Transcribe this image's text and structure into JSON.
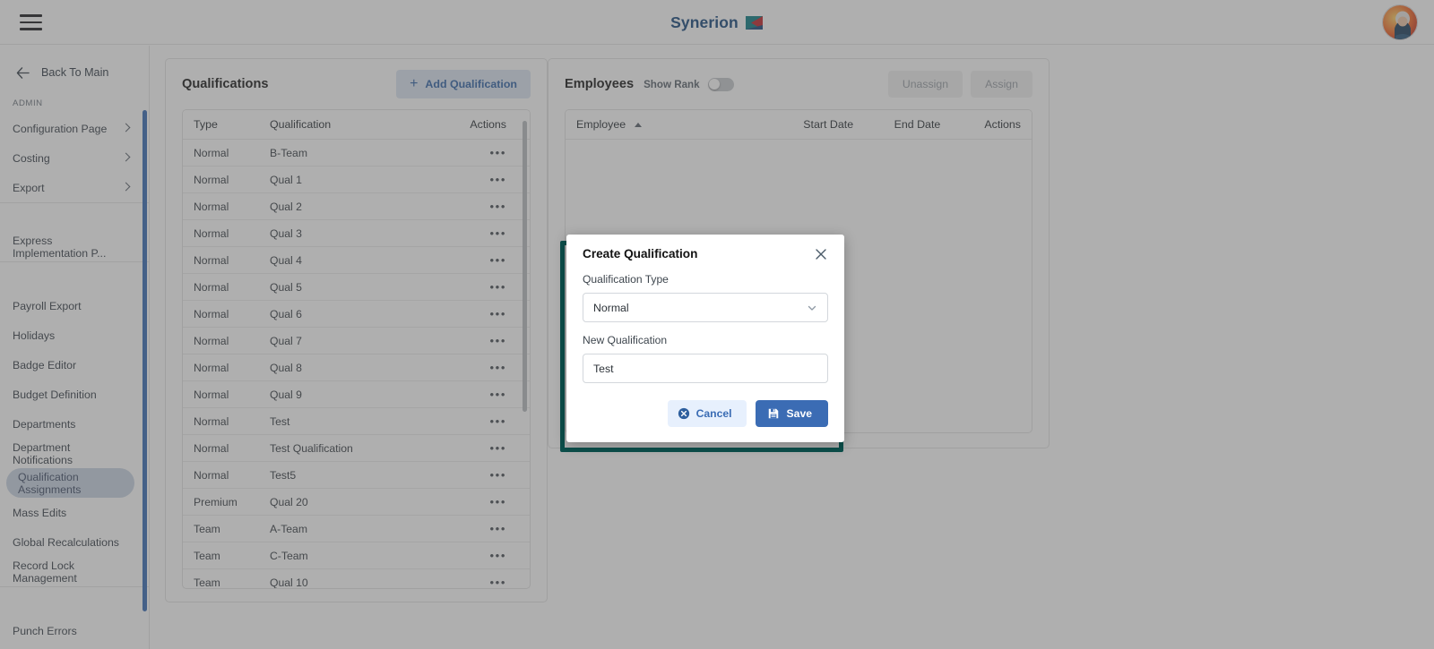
{
  "topbar": {
    "menu_icon": "hamburger-menu-icon",
    "brand_text": "Synerion",
    "brand_mark_icon": "synerion-logo-mark",
    "avatar_icon": "user-avatar"
  },
  "sidebar": {
    "back_label": "Back To Main",
    "back_icon": "arrow-left-icon",
    "section_label": "ADMIN",
    "groups": [
      {
        "items": [
          {
            "label": "Configuration Page",
            "expandable": true,
            "selected": false
          },
          {
            "label": "Costing",
            "expandable": true,
            "selected": false
          },
          {
            "label": "Export",
            "expandable": true,
            "selected": false
          }
        ]
      },
      {
        "items": [
          {
            "label": "Express Implementation P...",
            "expandable": false,
            "selected": false
          }
        ]
      },
      {
        "items": [
          {
            "label": "Payroll Export",
            "expandable": false,
            "selected": false
          },
          {
            "label": "Holidays",
            "expandable": false,
            "selected": false
          },
          {
            "label": "Badge Editor",
            "expandable": false,
            "selected": false
          },
          {
            "label": "Budget Definition",
            "expandable": false,
            "selected": false
          },
          {
            "label": "Departments",
            "expandable": false,
            "selected": false
          },
          {
            "label": "Department Notifications",
            "expandable": false,
            "selected": false
          },
          {
            "label": "Qualification Assignments",
            "expandable": false,
            "selected": true
          },
          {
            "label": "Mass Edits",
            "expandable": false,
            "selected": false
          },
          {
            "label": "Global Recalculations",
            "expandable": false,
            "selected": false
          },
          {
            "label": "Record Lock Management",
            "expandable": false,
            "selected": false
          }
        ]
      },
      {
        "items": [
          {
            "label": "Punch Errors",
            "expandable": false,
            "selected": false
          }
        ]
      }
    ],
    "scrollbar_color": "#3a6eb5"
  },
  "qualifications_panel": {
    "title": "Qualifications",
    "add_button_label": "Add Qualification",
    "add_button_icon": "plus-icon",
    "columns": [
      "Type",
      "Qualification",
      "Actions"
    ],
    "rows": [
      {
        "type": "Normal",
        "qualification": "B-Team"
      },
      {
        "type": "Normal",
        "qualification": "Qual 1"
      },
      {
        "type": "Normal",
        "qualification": "Qual 2"
      },
      {
        "type": "Normal",
        "qualification": "Qual 3"
      },
      {
        "type": "Normal",
        "qualification": "Qual 4"
      },
      {
        "type": "Normal",
        "qualification": "Qual 5"
      },
      {
        "type": "Normal",
        "qualification": "Qual 6"
      },
      {
        "type": "Normal",
        "qualification": "Qual 7"
      },
      {
        "type": "Normal",
        "qualification": "Qual 8"
      },
      {
        "type": "Normal",
        "qualification": "Qual 9"
      },
      {
        "type": "Normal",
        "qualification": "Test"
      },
      {
        "type": "Normal",
        "qualification": "Test Qualification"
      },
      {
        "type": "Normal",
        "qualification": "Test5"
      },
      {
        "type": "Premium",
        "qualification": "Qual 20"
      },
      {
        "type": "Team",
        "qualification": "A-Team"
      },
      {
        "type": "Team",
        "qualification": "C-Team"
      },
      {
        "type": "Team",
        "qualification": "Qual 10"
      }
    ],
    "row_action_icon": "ellipsis-menu-icon"
  },
  "employees_panel": {
    "title": "Employees",
    "show_rank_label": "Show Rank",
    "show_rank_on": false,
    "unassign_label": "Unassign",
    "assign_label": "Assign",
    "columns": [
      "Employee",
      "Start Date",
      "End Date",
      "Actions"
    ],
    "sort_column": "Employee",
    "sort_direction": "ascending",
    "sort_icon": "caret-up-icon",
    "rows": []
  },
  "modal": {
    "title": "Create Qualification",
    "close_icon": "close-icon",
    "type_label": "Qualification Type",
    "type_value": "Normal",
    "type_chevron_icon": "chevron-down-icon",
    "name_label": "New Qualification",
    "name_value": "Test",
    "name_placeholder": "",
    "cancel_label": "Cancel",
    "cancel_icon": "circle-x-icon",
    "save_label": "Save",
    "save_icon": "floppy-disk-icon",
    "focus_ring_color": "#0c4f4b",
    "primary_color": "#3b6cb4"
  }
}
